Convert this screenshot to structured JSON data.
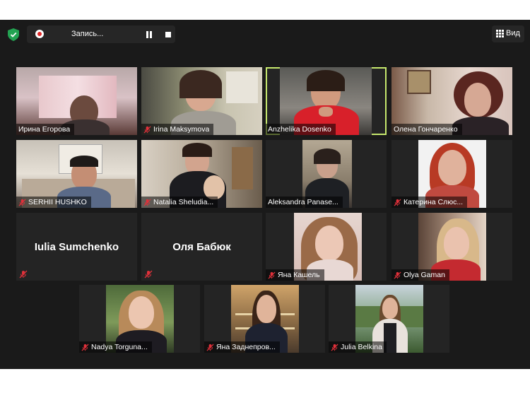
{
  "window": {
    "recording_label": "Запись...",
    "view_label": "Вид"
  },
  "colors": {
    "background": "#1a1a1a",
    "tile": "#242424",
    "active_speaker_border": "#c6e86d",
    "muted_mic": "#e0303a",
    "shield": "#23a352"
  },
  "participants": [
    {
      "name": "Ирина Егорова",
      "muted": false,
      "video": true
    },
    {
      "name": "Irina Maksymova",
      "muted": true,
      "video": true
    },
    {
      "name": "Anzhelika Dosenko",
      "muted": false,
      "video": true,
      "active": true
    },
    {
      "name": "Олена Гончаренко",
      "muted": false,
      "video": true
    },
    {
      "name": "SERHII HUSHKO",
      "muted": true,
      "video": true
    },
    {
      "name": "Natalia Sheludia...",
      "muted": true,
      "video": true
    },
    {
      "name": "Aleksandra Panase...",
      "muted": false,
      "video": true
    },
    {
      "name": "Катерина Слюс...",
      "muted": true,
      "video": true
    },
    {
      "name": "Iulia Sumchenko",
      "muted": true,
      "video": false
    },
    {
      "name": "Оля Бабюк",
      "muted": true,
      "video": false
    },
    {
      "name": "Яна Кашель",
      "muted": true,
      "video": true
    },
    {
      "name": "Olya Gaman",
      "muted": true,
      "video": true
    },
    {
      "name": "Nadya Torguna...",
      "muted": true,
      "video": true
    },
    {
      "name": "Яна Заднепров...",
      "muted": true,
      "video": true
    },
    {
      "name": "Julia Belkina",
      "muted": true,
      "video": true
    }
  ]
}
